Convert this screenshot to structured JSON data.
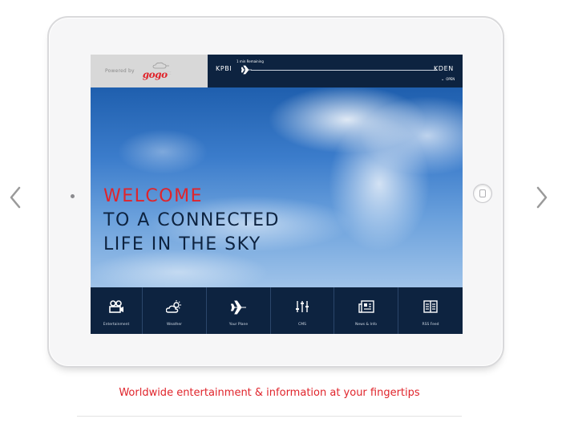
{
  "carousel": {
    "prev_icon": "chevron-left-icon",
    "next_icon": "chevron-right-icon",
    "tagline": "Worldwide entertainment & information at your fingertips"
  },
  "header": {
    "powered_by": "Powered by",
    "logo": "gogo",
    "origin": "KPBI",
    "destination": "KDEN",
    "time_remaining": "1 min Remaining",
    "open_label": "OPEN"
  },
  "hero": {
    "line1": "WELCOME",
    "line2": "TO A CONNECTED",
    "line3": "LIFE IN THE SKY"
  },
  "nav": {
    "items": [
      {
        "label": "Entertainment",
        "icon": "film-camera-icon"
      },
      {
        "label": "Weather",
        "icon": "weather-icon"
      },
      {
        "label": "Your Plane",
        "icon": "plane-icon"
      },
      {
        "label": "CMS",
        "icon": "sliders-icon"
      },
      {
        "label": "News & Info",
        "icon": "newspaper-icon"
      },
      {
        "label": "RSS Feed",
        "icon": "rss-feed-icon"
      }
    ]
  },
  "colors": {
    "accent_red": "#e0242b",
    "navy": "#0d2340"
  }
}
